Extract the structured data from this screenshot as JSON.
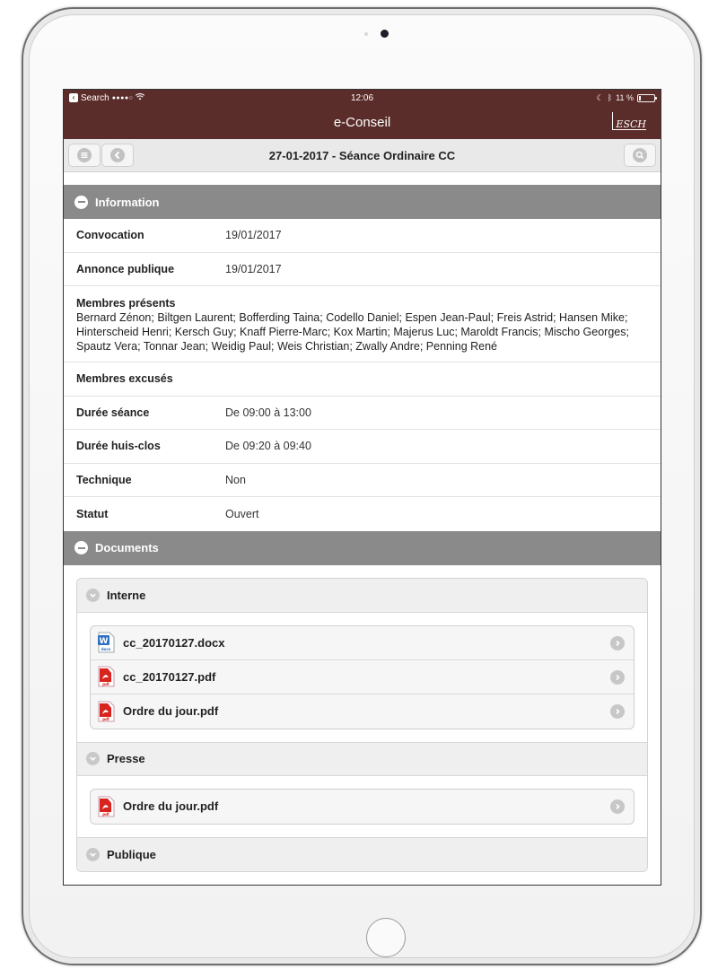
{
  "statusbar": {
    "back_label": "Search",
    "signal": "●●●●○",
    "wifi": "ᯤ",
    "time": "12:06",
    "battery_text": "11 %"
  },
  "appbar": {
    "title": "e-Conseil",
    "logo_text": "ESCH"
  },
  "toolbar": {
    "title": "27-01-2017 - Séance Ordinaire CC"
  },
  "information": {
    "header": "Information",
    "rows_top": [
      {
        "label": "Convocation",
        "value": "19/01/2017"
      },
      {
        "label": "Annonce publique",
        "value": "19/01/2017"
      }
    ],
    "members_present_label": "Membres présents",
    "members_present": "Bernard Zénon; Biltgen Laurent; Bofferding Taina; Codello Daniel; Espen Jean-Paul; Freis Astrid; Hansen Mike; Hinterscheid Henri; Kersch Guy; Knaff Pierre-Marc; Kox Martin; Majerus Luc; Maroldt Francis; Mischo Georges; Spautz Vera; Tonnar Jean; Weidig Paul; Weis Christian; Zwally Andre; Penning René",
    "members_excused_label": "Membres excusés",
    "rows_bottom": [
      {
        "label": "Durée séance",
        "value": "De 09:00 à 13:00"
      },
      {
        "label": "Durée huis-clos",
        "value": "De 09:20 à 09:40"
      },
      {
        "label": "Technique",
        "value": "Non"
      },
      {
        "label": "Statut",
        "value": "Ouvert"
      }
    ]
  },
  "documents": {
    "header": "Documents",
    "groups": [
      {
        "title": "Interne",
        "files": [
          {
            "name": "cc_20170127.docx",
            "icon": "word-doc-icon"
          },
          {
            "name": "cc_20170127.pdf",
            "icon": "pdf-icon"
          },
          {
            "name": "Ordre du jour.pdf",
            "icon": "pdf-icon"
          }
        ]
      },
      {
        "title": "Presse",
        "files": [
          {
            "name": "Ordre du jour.pdf",
            "icon": "pdf-icon"
          }
        ]
      },
      {
        "title": "Publique",
        "files": []
      }
    ]
  },
  "colors": {
    "brand": "#5b2d2a",
    "section_header": "#8a8a8a"
  }
}
